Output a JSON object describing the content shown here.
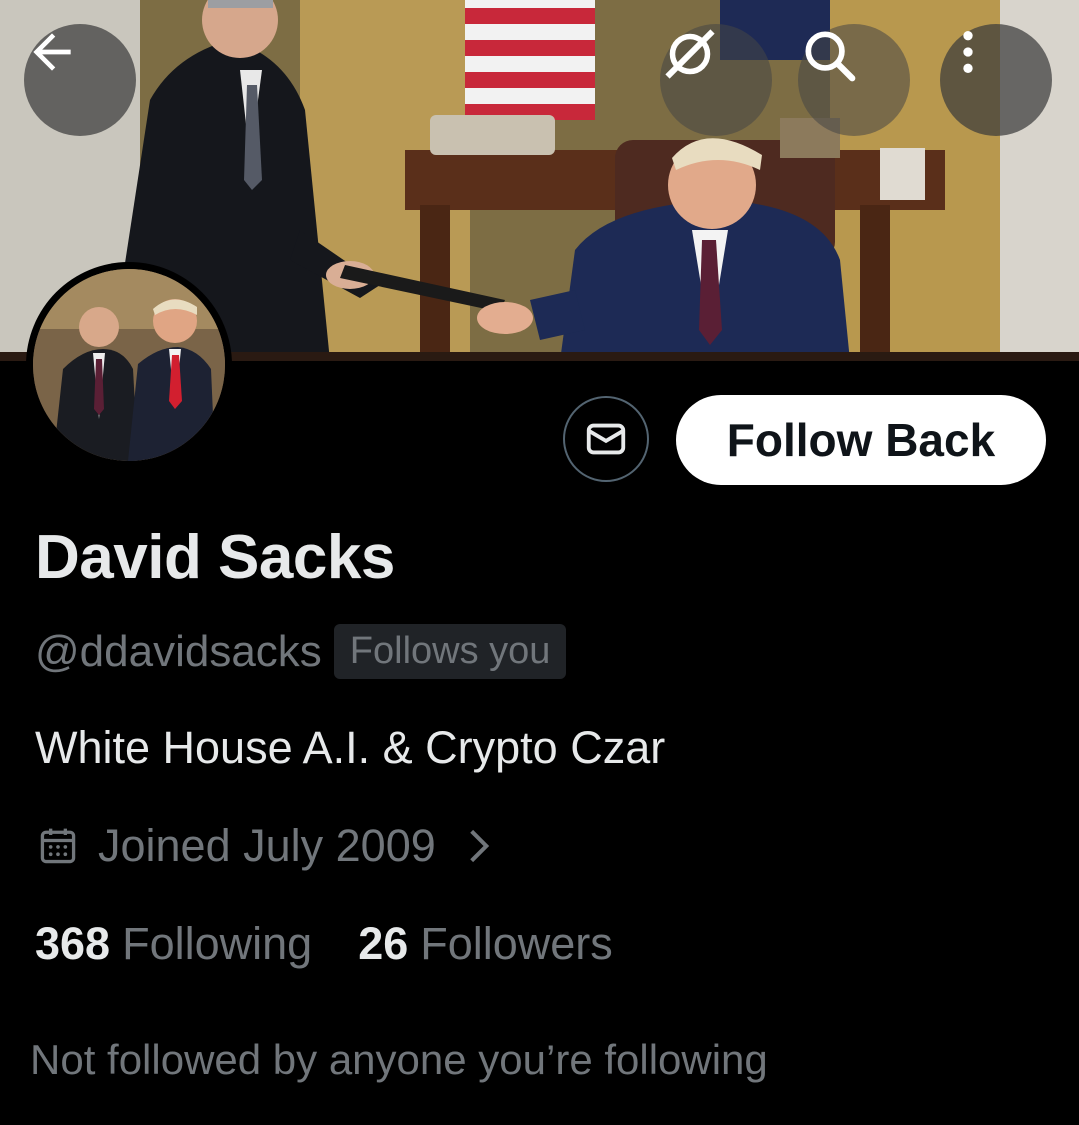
{
  "header": {
    "back_icon": "arrow-left-icon",
    "grok_icon": "grok-icon",
    "search_icon": "search-icon",
    "more_icon": "more-vertical-icon"
  },
  "profile": {
    "name": "David Sacks",
    "handle": "@ddavidsacks",
    "follows_you_badge": "Follows you",
    "bio": "White House A.I. & Crypto Czar",
    "joined": "Joined July 2009",
    "following_count": "368",
    "following_label": "Following",
    "followers_count": "26",
    "followers_label": "Followers",
    "mutuals_note": "Not followed by anyone you’re following"
  },
  "actions": {
    "message_icon": "envelope-icon",
    "follow_back_label": "Follow Back"
  },
  "colors": {
    "background": "#000000",
    "primary_text": "#e7e9ea",
    "secondary_text": "#71767b",
    "follow_button_bg": "#ffffff"
  }
}
